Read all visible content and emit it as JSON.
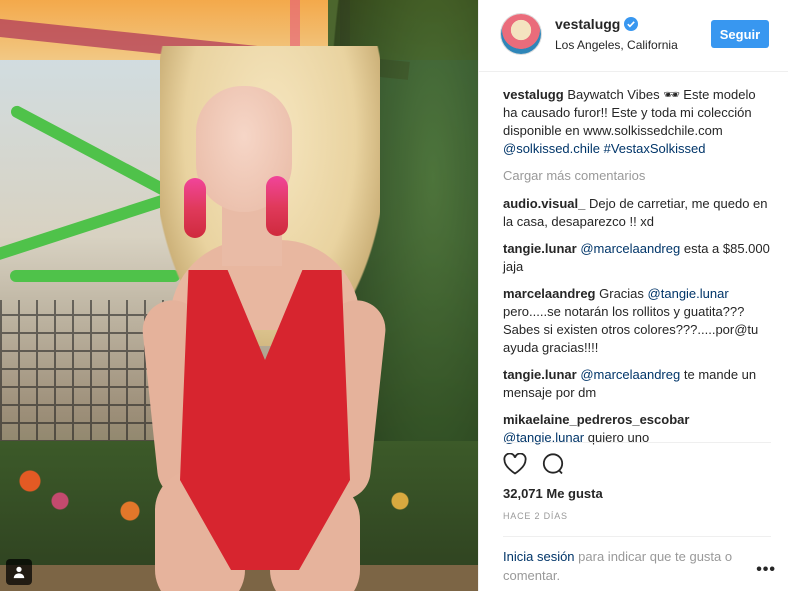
{
  "post": {
    "username": "vestalugg",
    "location": "Los Angeles, California",
    "follow_label": "Seguir",
    "caption": {
      "user": "vestalugg",
      "text": "Baywatch Vibes 🕶 Este modelo ha causado furor!! Este y toda mi colección disponible en www.solkissedchile.com",
      "mentions": "@solkissed.chile #VestaxSolkissed"
    },
    "load_more": "Cargar más comentarios",
    "comments": [
      {
        "user": "audio.visual_",
        "mention": "",
        "text": "Dejo de carretiar, me quedo en la casa, desaparezco !! xd"
      },
      {
        "user": "tangie.lunar",
        "mention": "@marcelaandreg",
        "text": "esta a $85.000 jaja"
      },
      {
        "user": "marcelaandreg",
        "text_before": "Gracias",
        "mention": "@tangie.lunar",
        "text": "pero.....se notarán los rollitos y guatita??? Sabes si existen otros colores???.....por@tu ayuda gracias!!!!"
      },
      {
        "user": "tangie.lunar",
        "mention": "@marcelaandreg",
        "text": "te mande un mensaje por dm"
      },
      {
        "user": "mikaelaine_pedreros_escobar",
        "mention": "@tangie.lunar",
        "text": "quiero uno"
      }
    ],
    "likes": "32,071 Me gusta",
    "time": "HACE 2 DÍAS",
    "login_link": "Inicia sesión",
    "login_text": "para indicar que te gusta o comentar.",
    "more_label": "•••"
  },
  "icons": {
    "like": "heart-icon",
    "comment": "comment-icon",
    "verified": "verified-badge-icon",
    "tag": "user-tag-icon",
    "options": "more-options-icon"
  },
  "colors": {
    "follow_button": "#3897f0",
    "link": "#003569",
    "muted": "#999999",
    "verified": "#3897f0"
  }
}
